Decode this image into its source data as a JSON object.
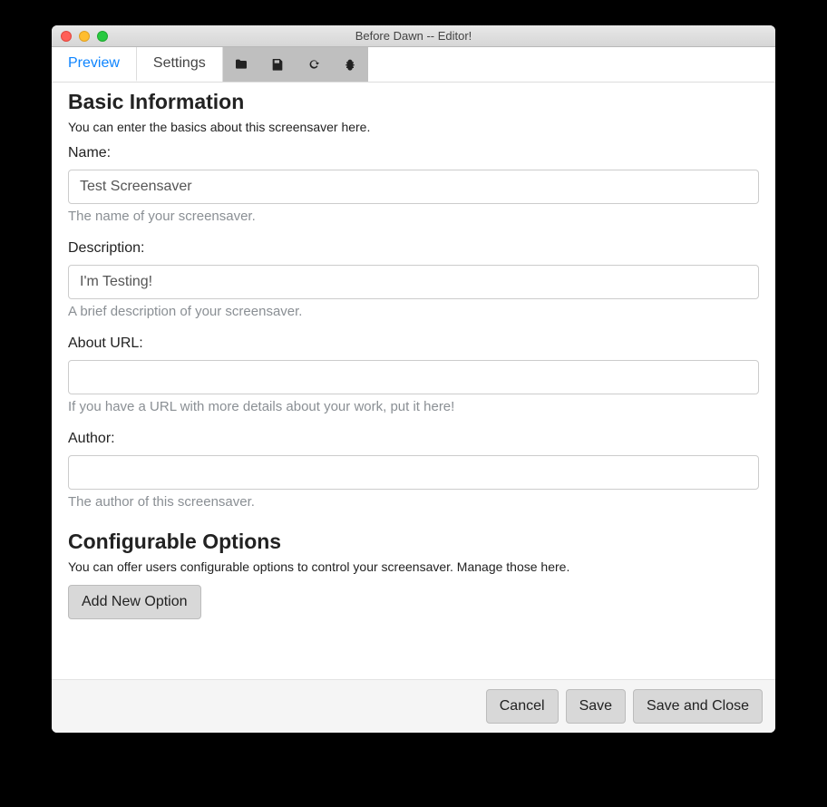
{
  "window": {
    "title": "Before Dawn -- Editor!"
  },
  "tabs": {
    "preview": "Preview",
    "settings": "Settings"
  },
  "toolbarIcons": {
    "folder": "folder-icon",
    "save": "save-icon",
    "reload": "reload-icon",
    "bug": "bug-icon"
  },
  "basic": {
    "heading": "Basic Information",
    "sub": "You can enter the basics about this screensaver here.",
    "name": {
      "label": "Name:",
      "value": "Test Screensaver",
      "hint": "The name of your screensaver."
    },
    "description": {
      "label": "Description:",
      "value": "I'm Testing!",
      "hint": "A brief description of your screensaver."
    },
    "aboutUrl": {
      "label": "About URL:",
      "value": "",
      "hint": "If you have a URL with more details about your work, put it here!"
    },
    "author": {
      "label": "Author:",
      "value": "",
      "hint": "The author of this screensaver."
    }
  },
  "options": {
    "heading": "Configurable Options",
    "sub": "You can offer users configurable options to control your screensaver. Manage those here.",
    "addBtn": "Add New Option"
  },
  "footer": {
    "cancel": "Cancel",
    "save": "Save",
    "saveClose": "Save and Close"
  }
}
